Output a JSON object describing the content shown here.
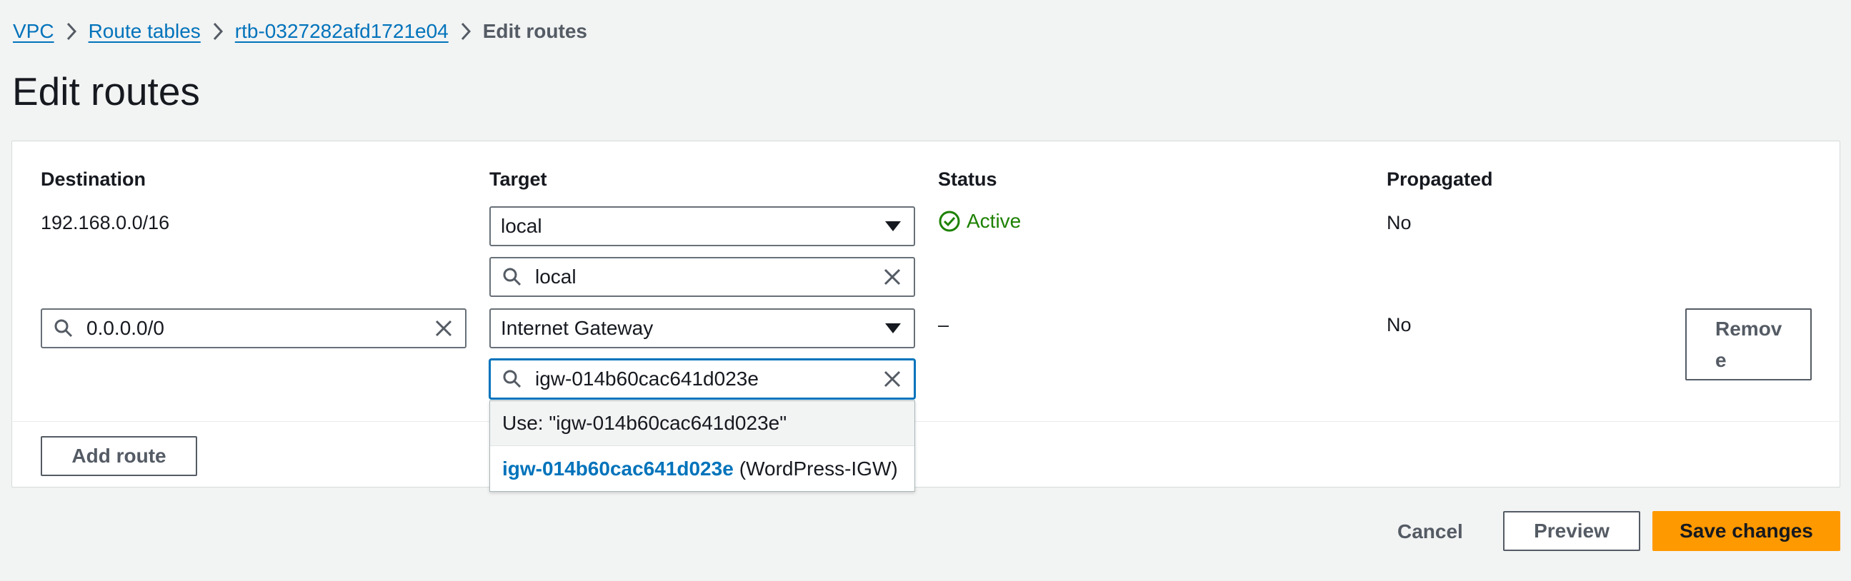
{
  "breadcrumb": {
    "items": [
      "VPC",
      "Route tables",
      "rtb-0327282afd1721e04"
    ],
    "current": "Edit routes"
  },
  "page": {
    "title": "Edit routes"
  },
  "table": {
    "headers": {
      "destination": "Destination",
      "target": "Target",
      "status": "Status",
      "propagated": "Propagated"
    },
    "rows": [
      {
        "destination": "192.168.0.0/16",
        "target_select": "local",
        "target_search": "local",
        "status": "Active",
        "propagated": "No"
      },
      {
        "destination_input": "0.0.0.0/0",
        "target_select": "Internet Gateway",
        "target_search": "igw-014b60cac641d023e",
        "status": "–",
        "propagated": "No",
        "remove_label_line1": "Remov",
        "remove_label_line2": "e"
      }
    ],
    "add_route_label": "Add route"
  },
  "dropdown": {
    "use_option": "Use: \"igw-014b60cac641d023e\"",
    "option_id": "igw-014b60cac641d023e",
    "option_name": "(WordPress-IGW)"
  },
  "footer": {
    "cancel_label": "Cancel",
    "preview_label": "Preview",
    "save_label": "Save changes"
  },
  "colors": {
    "link": "#0073bb",
    "success": "#1d8102",
    "primary": "#ff9900",
    "background": "#f2f3f3"
  },
  "icons": [
    "chevron-right-icon",
    "search-icon",
    "clear-icon",
    "caret-down-icon",
    "status-check-icon"
  ]
}
